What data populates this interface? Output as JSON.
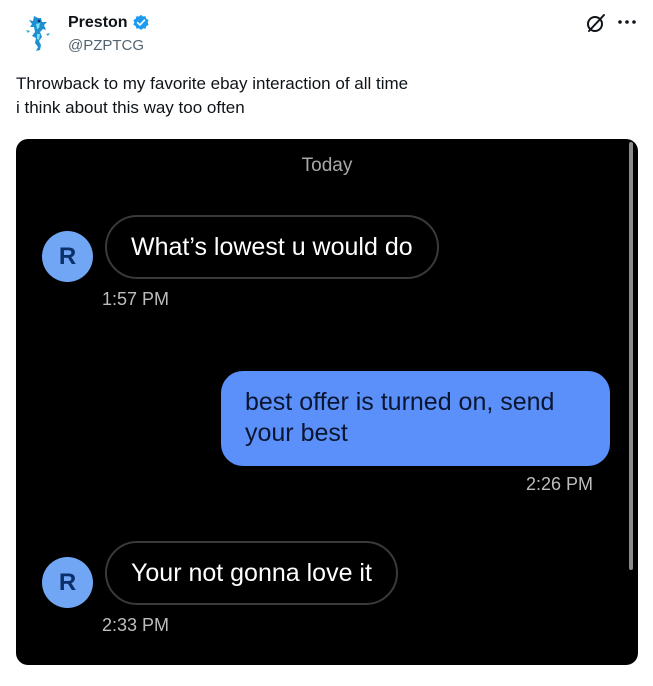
{
  "author": {
    "name": "Preston",
    "handle": "@PZPTCG",
    "verified": true
  },
  "tweet": {
    "lines": [
      "Throwback to my favorite ebay interaction of all time",
      "i think about this way too often"
    ]
  },
  "media": {
    "day_label": "Today",
    "messages": [
      {
        "sender": "them",
        "avatar_letter": "R",
        "text": "What’s lowest u would do",
        "time": "1:57 PM"
      },
      {
        "sender": "me",
        "lines": [
          "best offer is turned on, send",
          "your best"
        ],
        "time": "2:26 PM"
      },
      {
        "sender": "them",
        "avatar_letter": "R",
        "text": "Your not gonna love it",
        "time": "2:33 PM"
      }
    ]
  },
  "colors": {
    "verified_badge": "#1d9bf0",
    "outgoing_bubble": "#5b8ff9",
    "incoming_avatar": "#70a6f4",
    "media_background": "#000000"
  },
  "icons": {
    "grok": "slashed-circle-icon",
    "more": "more-horizontal-icon"
  }
}
